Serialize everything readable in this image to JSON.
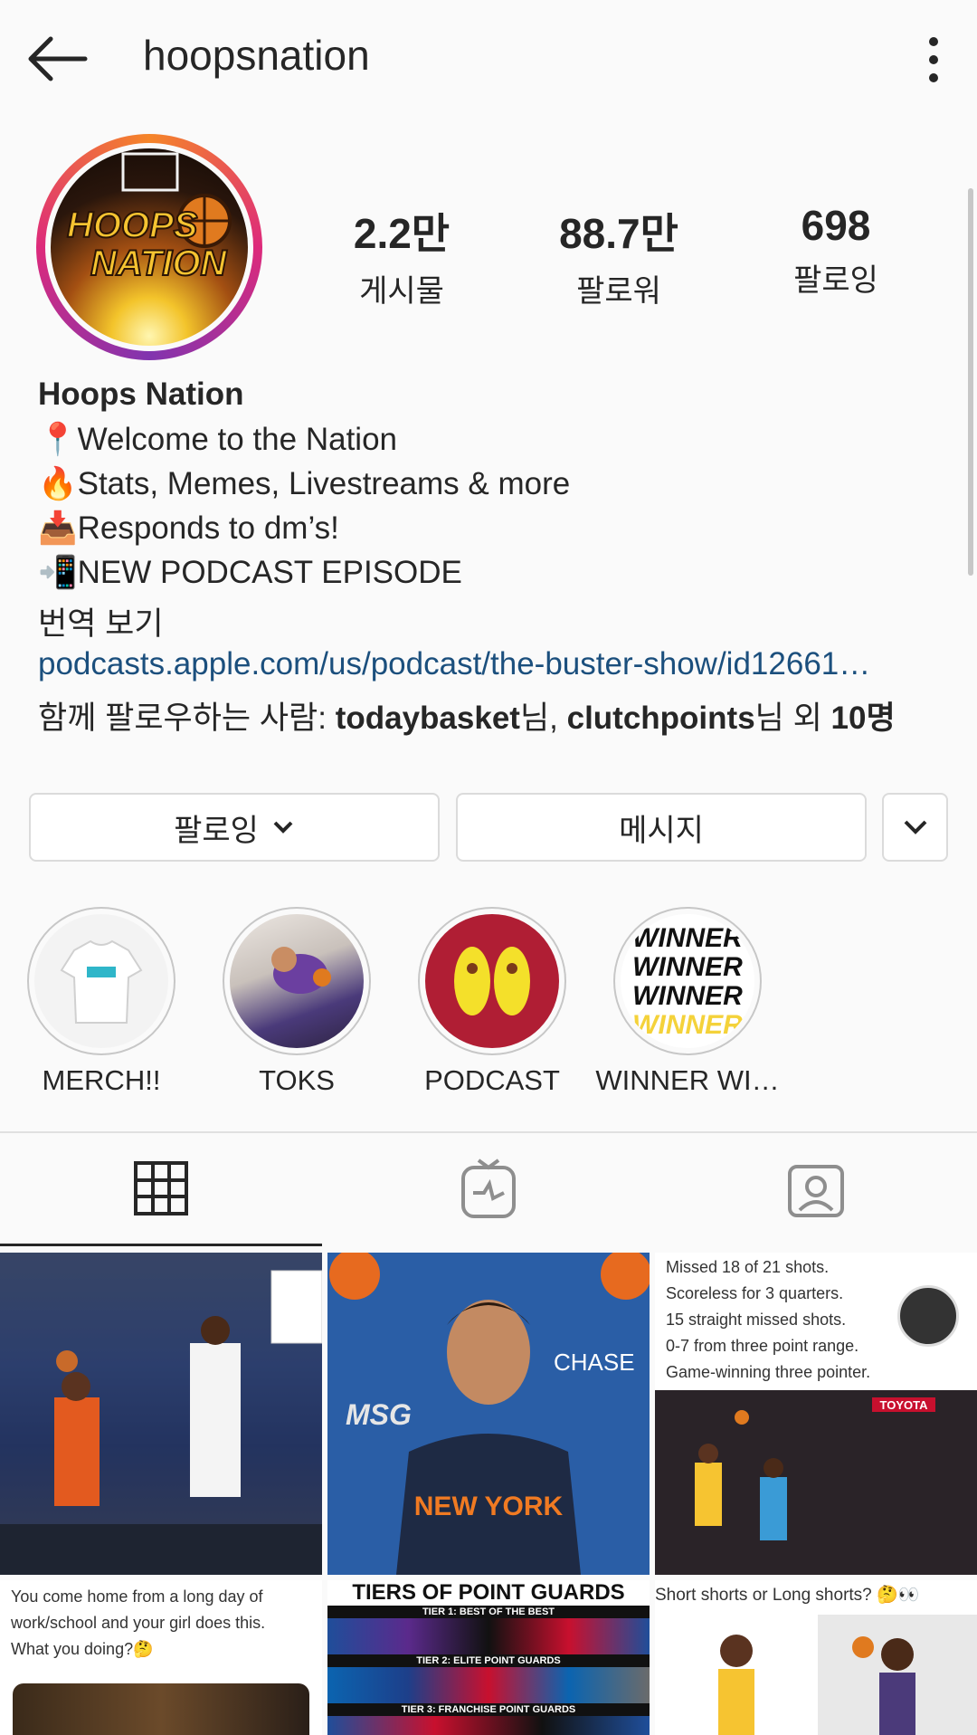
{
  "header": {
    "title": "hoopsnation",
    "back_icon": "arrow-left-icon",
    "more_icon": "vertical-dots-icon"
  },
  "profile": {
    "avatar_text_line1": "HOOPS",
    "avatar_text_line2": "NATION",
    "stats": [
      {
        "value": "2.2만",
        "label": "게시물"
      },
      {
        "value": "88.7만",
        "label": "팔로워"
      },
      {
        "value": "698",
        "label": "팔로잉"
      }
    ],
    "name": "Hoops Nation",
    "bio_lines": [
      {
        "emoji": "📍",
        "text": "Welcome to the Nation"
      },
      {
        "emoji": "🔥",
        "text": "Stats, Memes, Livestreams & more"
      },
      {
        "emoji": "📥",
        "text": "Responds to dm’s!"
      },
      {
        "emoji": "📲",
        "text": "NEW PODCAST EPISODE"
      }
    ],
    "translate": "번역 보기",
    "link": "podcasts.apple.com/us/podcast/the-buster-show/id12661…",
    "followed_by": {
      "prefix": "함께 팔로우하는 사람: ",
      "user1": "todaybasket",
      "suffix1": "님, ",
      "user2": "clutchpoints",
      "suffix2": "님 외 ",
      "count": "10명"
    }
  },
  "actions": {
    "following_label": "팔로잉",
    "message_label": "메시지"
  },
  "highlights": [
    {
      "label": "MERCH!!"
    },
    {
      "label": "TOKS"
    },
    {
      "label": "PODCAST"
    },
    {
      "label": "WINNER WI…"
    }
  ],
  "winner_word": "WINNER",
  "tabs": [
    "grid-icon",
    "igtv-icon",
    "tagged-icon"
  ],
  "posts": {
    "tile3_lines": [
      "Missed 18 of 21 shots.",
      "Scoreless for 3 quarters.",
      "15 straight missed shots.",
      "0-7 from three point range.",
      "Game-winning three pointer."
    ],
    "tile3_sponsor": "TOYOTA",
    "tile2_jersey_line1": "NEW YORK",
    "tile2_banner": "CHASE",
    "tile2_logo": "MSG",
    "tile4_lines": [
      "You come home from a long day of",
      "work/school and your girl does this.",
      "What you doing?🤔"
    ],
    "tile5_title": "TIERS OF POINT GUARDS",
    "tile5_tier1": "TIER 1: BEST OF THE BEST",
    "tile5_tier2": "TIER 2: ELITE POINT GUARDS",
    "tile5_tier3": "TIER 3: FRANCHISE POINT GUARDS",
    "tile6_text": "Short shorts or Long shorts? 🤔👀"
  },
  "colors": {
    "link": "#1b4f7d",
    "text": "#262626",
    "border": "#dbdbdb",
    "background": "#fafafa"
  }
}
